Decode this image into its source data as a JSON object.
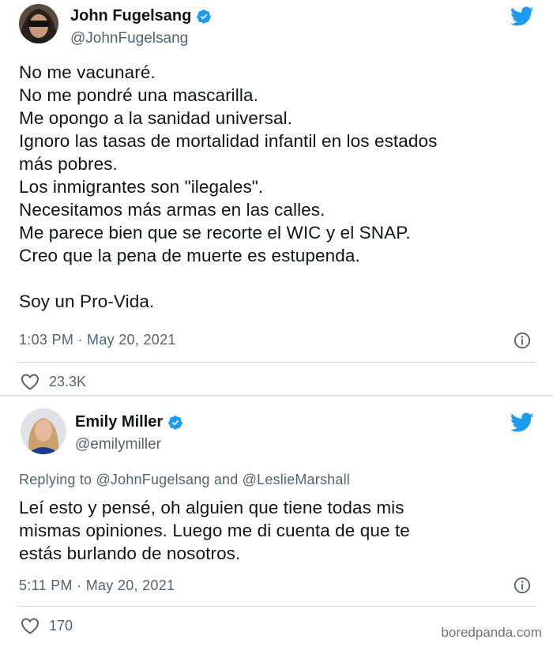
{
  "tweets": [
    {
      "author_name": "John Fugelsang",
      "author_handle": "@JohnFugelsang",
      "text": "No me vacunaré.\nNo me pondré una mascarilla.\nMe opongo a la sanidad universal.\nIgnoro las tasas de mortalidad infantil en los estados\nmás pobres.\nLos inmigrantes son \"ilegales\".\nNecesitamos más armas en las calles.\nMe parece bien que se recorte el WIC y el SNAP.\nCreo que la pena de muerte es estupenda.\n\nSoy un Pro-Vida.",
      "timestamp": "1:03 PM · May 20, 2021",
      "likes": "23.3K"
    },
    {
      "author_name": "Emily Miller",
      "author_handle": "@emilymiller",
      "replying_to": "Replying to @JohnFugelsang and @LeslieMarshall",
      "text": "Leí esto y pensé, oh alguien que tiene todas mis\nmismas opiniones. Luego me di cuenta de que te\nestás burlando de nosotros.",
      "timestamp": "5:11 PM · May 20, 2021",
      "likes": "170"
    }
  ],
  "watermark": "boredpanda.com",
  "colors": {
    "verified": "#1d9bf0",
    "twitter_blue": "#1d9bf0",
    "secondary_text": "#536471"
  },
  "icons": [
    "avatar",
    "verified-badge-icon",
    "twitter-bird-icon",
    "info-icon",
    "heart-icon"
  ]
}
